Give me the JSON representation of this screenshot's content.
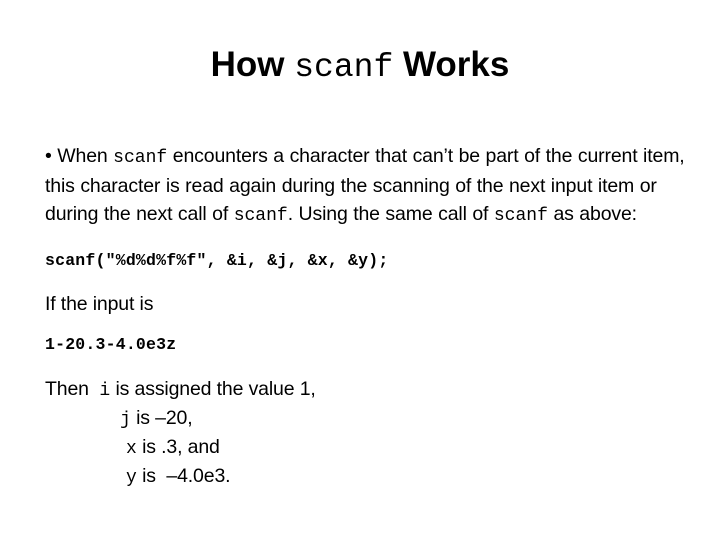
{
  "slide": {
    "background_color": "#ffffff",
    "text_color": "#000000",
    "title": {
      "pre": "How ",
      "mono": "scanf",
      "post": " Works"
    },
    "bullet": {
      "marker": "•",
      "seg1": " When ",
      "mono1": "scanf",
      "seg2": " encounters a character that can’t be part of the current item, this character is read again during the scanning of the next input item or during the next call of ",
      "mono2": "scanf",
      "seg3": ".  Using the same call of ",
      "mono3": "scanf",
      "seg4": "  as above:"
    },
    "code_call": "scanf(\"%d%d%f%f\", &i, &j, &x, &y);",
    "input_label": "If the input is",
    "input_value": "1-20.3-4.0e3z",
    "then": {
      "label": "Then  ",
      "rows": [
        {
          "var": "i",
          "text": " is assigned the value 1,"
        },
        {
          "var": "j",
          "text": " is –20,"
        },
        {
          "var": "x",
          "text": " is .3, and"
        },
        {
          "var": "y",
          "text": " is  –4.0e3."
        }
      ]
    }
  }
}
